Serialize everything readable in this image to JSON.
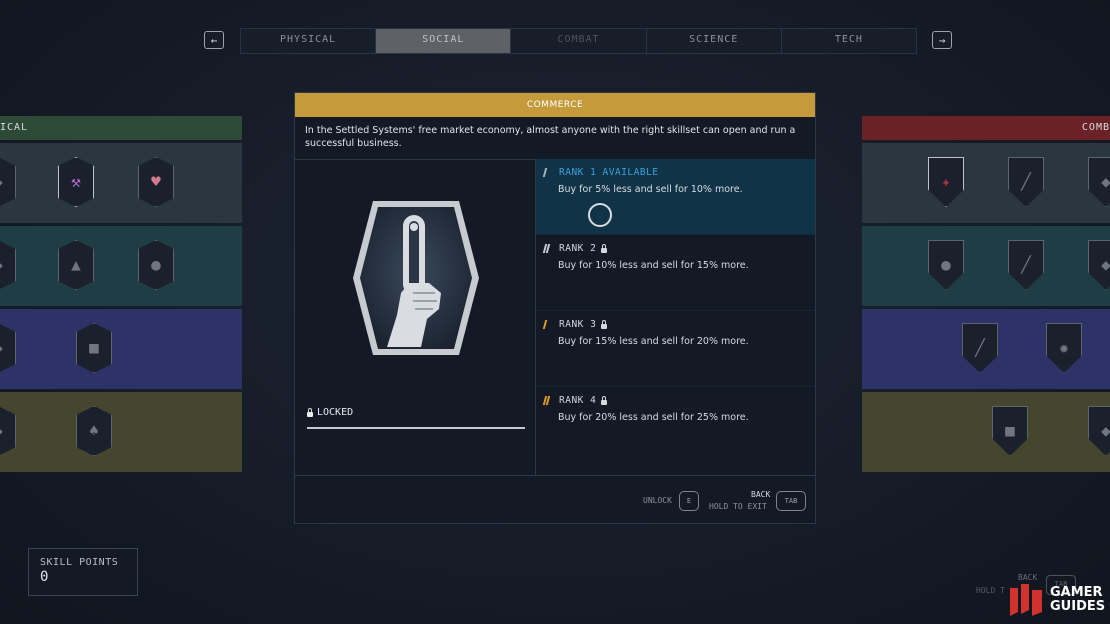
{
  "nav": {
    "prev_arrow": "←",
    "next_arrow": "→",
    "tabs": [
      {
        "label": "PHYSICAL"
      },
      {
        "label": "SOCIAL"
      },
      {
        "label": "COMBAT"
      },
      {
        "label": "SCIENCE"
      },
      {
        "label": "TECH"
      }
    ]
  },
  "side_left": {
    "header": "ICAL"
  },
  "side_right": {
    "header": "COMB"
  },
  "modal": {
    "title": "COMMERCE",
    "description": "In the Settled Systems' free market economy, almost anyone with the right skillset can open and run a successful business.",
    "status": "LOCKED",
    "ranks": [
      {
        "title": "RANK 1 AVAILABLE",
        "desc": "Buy for 5% less and sell for 10% more.",
        "pip_color": "#a9b0b8"
      },
      {
        "title": "RANK 2",
        "desc": "Buy for 10% less and sell for 15% more.",
        "pip_color": "#c8ccd2"
      },
      {
        "title": "RANK 3",
        "desc": "Buy for 15% less and sell for 20% more.",
        "pip_color": "#e39a27"
      },
      {
        "title": "RANK 4",
        "desc": "Buy for 20% less and sell for 25% more.",
        "pip_color": "#e39a27"
      }
    ],
    "footer": {
      "unlock_label": "UNLOCK",
      "unlock_key": "E",
      "back_label": "BACK",
      "hold_label": "HOLD TO EXIT",
      "tab_key": "TAB"
    }
  },
  "skill_points": {
    "label": "SKILL POINTS",
    "value": "0"
  },
  "corner": {
    "back_label": "BACK",
    "hold_label": "HOLD T",
    "key": "TAB"
  },
  "watermark": {
    "line1": "GAMER",
    "line2": "GUIDES"
  },
  "colors": {
    "accent_gold": "#c49a3b",
    "rank_active_bg": "#103347",
    "rank_active_text": "#3aa2e0"
  }
}
